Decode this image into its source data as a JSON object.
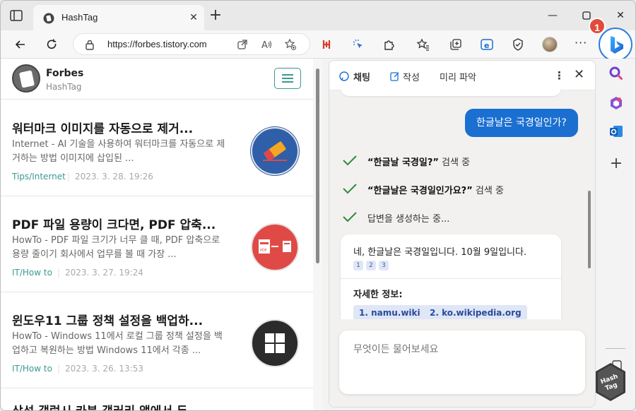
{
  "browser": {
    "tab_title": "HashTag",
    "url": "https://forbes.tistory.com",
    "badge_number": "1",
    "accent_color": "#1a6fd1"
  },
  "site": {
    "blog_name": "Forbes",
    "blog_sub": "HashTag",
    "posts": [
      {
        "title": "워터마크 이미지를 자동으로 제거...",
        "desc": "Internet - AI 기술을 사용하여 워터마크를 자동으로 제거하는 방법 이미지에 삽입된 ...",
        "category": "Tips/Internet",
        "date": "2023. 3. 28. 19:26",
        "icon": "eraser-icon"
      },
      {
        "title": "PDF 파일 용량이 크다면, PDF 압축...",
        "desc": "HowTo - PDF 파일 크기가 너무 클 때, PDF 압축으로 용량 줄이기 회사에서 업무를 볼 때 가장 ...",
        "category": "IT/How to",
        "date": "2023. 3. 27. 19:24",
        "icon": "pdf-compress-icon"
      },
      {
        "title": "윈도우11 그룹 정책 설정을 백업하...",
        "desc": "HowTo - Windows 11에서 로컬 그룹 정책 설정을 백업하고 복원하는 방법 Windows 11에서 각종 ...",
        "category": "IT/How to",
        "date": "2023. 3. 26. 13:53",
        "icon": "windows-logo-icon"
      }
    ],
    "partial_post_title": "삼성 갤럭시 카북 갤러리 앱에서 두..."
  },
  "chat": {
    "tabs": [
      "채팅",
      "작성",
      "미리 파악"
    ],
    "user_message": "한글날은 국경일인가?",
    "steps": [
      {
        "quoted": "“한글날 국경일?”",
        "suffix": " 검색 중"
      },
      {
        "quoted": "“한글날은 국경일인가요?”",
        "suffix": " 검색 중"
      },
      {
        "quoted": "",
        "suffix": "답변을 생성하는 중..."
      }
    ],
    "answer": "네, 한글날은 국경일입니다. 10월 9일입니다.",
    "citations": [
      "1",
      "2",
      "3"
    ],
    "more_info_title": "자세한 정보:",
    "sources": [
      "1. namu.wiki",
      "2. ko.wikipedia.org"
    ],
    "input_placeholder": "무엇이든 물어보세요"
  }
}
